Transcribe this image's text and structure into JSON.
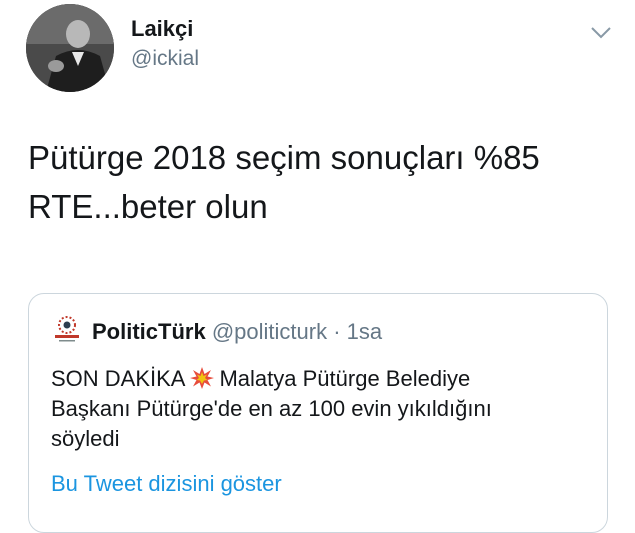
{
  "author": {
    "display_name": "Laikçi",
    "handle": "@ickial"
  },
  "tweet": {
    "line1": "Pütürge 2018 seçim sonuçları %85",
    "line2": "RTE...beter olun"
  },
  "quoted_tweet": {
    "display_name": "PoliticTürk",
    "handle": "@politicturk",
    "separator": "·",
    "time": "1sa",
    "text_line1_pre": "SON DAKİKA",
    "text_line1_post": "Malatya Pütürge Belediye",
    "text_line2": "Başkanı Pütürge'de en az 100 evin yıkıldığını",
    "text_line3": "söyledi",
    "emoji_icon": "collision-icon",
    "show_thread": "Bu Tweet dizisini göster"
  },
  "colors": {
    "text": "#14171a",
    "secondary": "#657786",
    "link": "#1b95e0",
    "border": "#ccd6dd"
  }
}
